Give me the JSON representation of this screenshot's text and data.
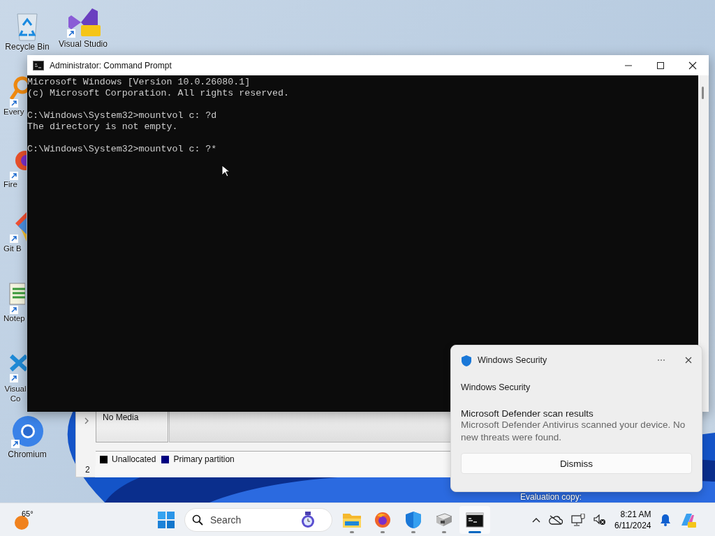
{
  "desktop": {
    "icons": [
      {
        "kind": "recycle",
        "label": "Recycle Bin"
      },
      {
        "kind": "studio",
        "label": "Visual Studio"
      },
      {
        "kind": "search",
        "label": "Every"
      },
      {
        "kind": "fox",
        "label": "Fire"
      },
      {
        "kind": "git",
        "label": "Git B"
      },
      {
        "kind": "notepad",
        "label": "Notep"
      },
      {
        "kind": "code",
        "label": "Visual Co"
      },
      {
        "kind": "chromium",
        "label": "Chromium"
      }
    ]
  },
  "background_window": {
    "cell": "No Media",
    "legend": [
      {
        "label": "Unallocated",
        "color": "#000000"
      },
      {
        "label": "Primary partition",
        "color": "#000080"
      }
    ],
    "status": "2"
  },
  "command_prompt": {
    "title": "Administrator: Command Prompt",
    "blocks": [
      [
        "Microsoft Windows [Version 10.0.26080.1]",
        "(c) Microsoft Corporation. All rights reserved."
      ],
      [
        "C:\\Windows\\System32>mountvol c: ?d",
        "The directory is not empty."
      ],
      [
        "C:\\Windows\\System32>mountvol c: ?*"
      ]
    ]
  },
  "notification": {
    "app": "Windows Security",
    "attribution": "Windows Security",
    "title": "Microsoft Defender scan results",
    "body": "Microsoft Defender Antivirus scanned your device. No new threats were found.",
    "button": "Dismiss"
  },
  "watermark": "Evaluation copy:",
  "taskbar": {
    "weather": {
      "temperature": "65°"
    },
    "search": {
      "placeholder": "Search"
    },
    "apps": [
      {
        "kind": "folder",
        "selected": false
      },
      {
        "kind": "fox",
        "selected": false
      },
      {
        "kind": "shield",
        "selected": false
      },
      {
        "kind": "tool",
        "selected": false
      },
      {
        "kind": "terminal",
        "selected": true
      }
    ],
    "clock": {
      "time": "8:21 AM",
      "date": "6/11/2024"
    }
  }
}
